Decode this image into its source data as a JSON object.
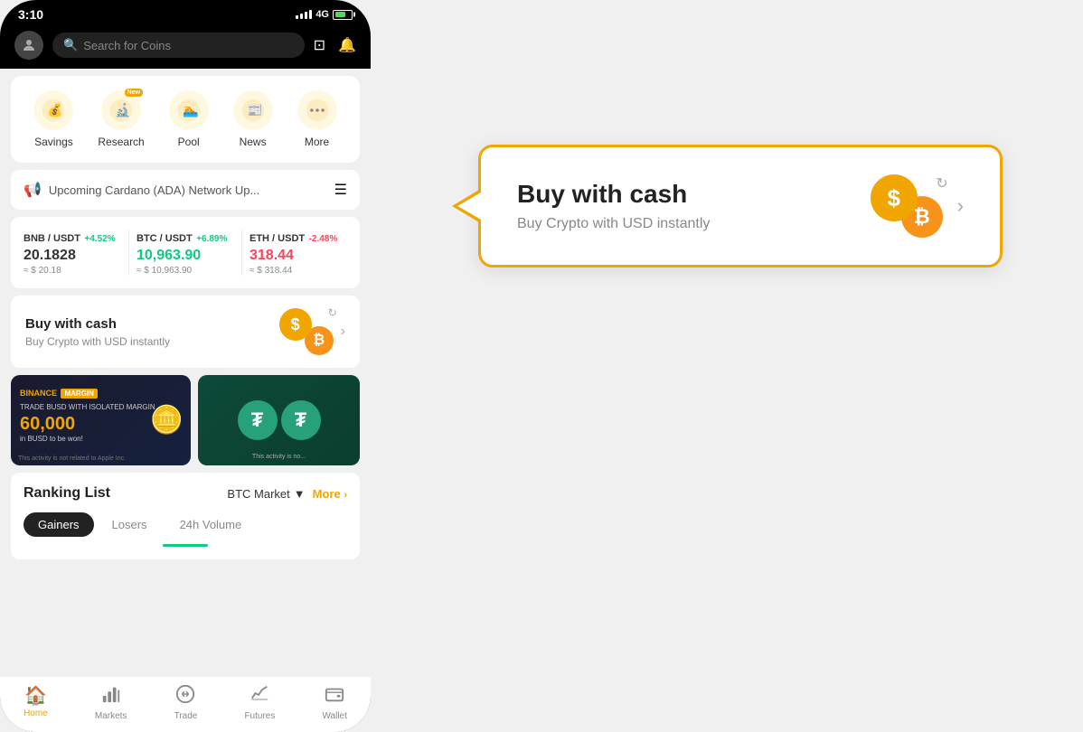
{
  "status_bar": {
    "time": "3:10",
    "network": "4G"
  },
  "header": {
    "search_placeholder": "Search for Coins"
  },
  "quick_actions": {
    "items": [
      {
        "id": "savings",
        "label": "Savings",
        "icon": "💰",
        "bg": "#fff8e1",
        "new": false
      },
      {
        "id": "research",
        "label": "Research",
        "icon": "🔬",
        "bg": "#fff8e1",
        "new": true
      },
      {
        "id": "pool",
        "label": "Pool",
        "icon": "🏊",
        "bg": "#fff8e1",
        "new": false
      },
      {
        "id": "news",
        "label": "News",
        "icon": "📰",
        "bg": "#fff8e1",
        "new": false
      },
      {
        "id": "more",
        "label": "More",
        "icon": "⋯",
        "bg": "#fff8e1",
        "new": false
      }
    ]
  },
  "announcement": {
    "text": "Upcoming Cardano (ADA) Network Up..."
  },
  "tickers": [
    {
      "pair": "BNB / USDT",
      "change": "+4.52%",
      "change_type": "pos",
      "price": "20.1828",
      "price_type": "neutral",
      "usd": "≈ $ 20.18"
    },
    {
      "pair": "BTC / USDT",
      "change": "+6.89%",
      "change_type": "pos",
      "price": "10,963.90",
      "price_type": "pos",
      "usd": "≈ $ 10,963.90"
    },
    {
      "pair": "ETH / USDT",
      "change": "-2.48%",
      "change_type": "neg",
      "price": "318.44",
      "price_type": "neg",
      "usd": "≈ $ 318.44"
    }
  ],
  "buy_cash": {
    "title": "Buy with cash",
    "subtitle": "Buy Crypto with USD instantly"
  },
  "banner1": {
    "brand": "BINANCE",
    "tag": "MARGIN",
    "trade_text": "TRADE BUSD WITH ISOLATED MARGIN",
    "amount": "60,000",
    "unit": "in BUSD to be won!",
    "disclaimer": "This activity is not related to Apple Inc."
  },
  "ranking": {
    "title": "Ranking List",
    "market": "BTC Market",
    "more_label": "More",
    "tabs": [
      "Gainers",
      "Losers",
      "24h Volume"
    ]
  },
  "bottom_nav": {
    "items": [
      {
        "id": "home",
        "label": "Home",
        "icon": "🏠",
        "active": true
      },
      {
        "id": "markets",
        "label": "Markets",
        "icon": "📊",
        "active": false
      },
      {
        "id": "trade",
        "label": "Trade",
        "icon": "🔄",
        "active": false
      },
      {
        "id": "futures",
        "label": "Futures",
        "icon": "📈",
        "active": false
      },
      {
        "id": "wallet",
        "label": "Wallet",
        "icon": "👛",
        "active": false
      }
    ]
  },
  "callout": {
    "title": "Buy with cash",
    "subtitle": "Buy Crypto with USD instantly"
  }
}
